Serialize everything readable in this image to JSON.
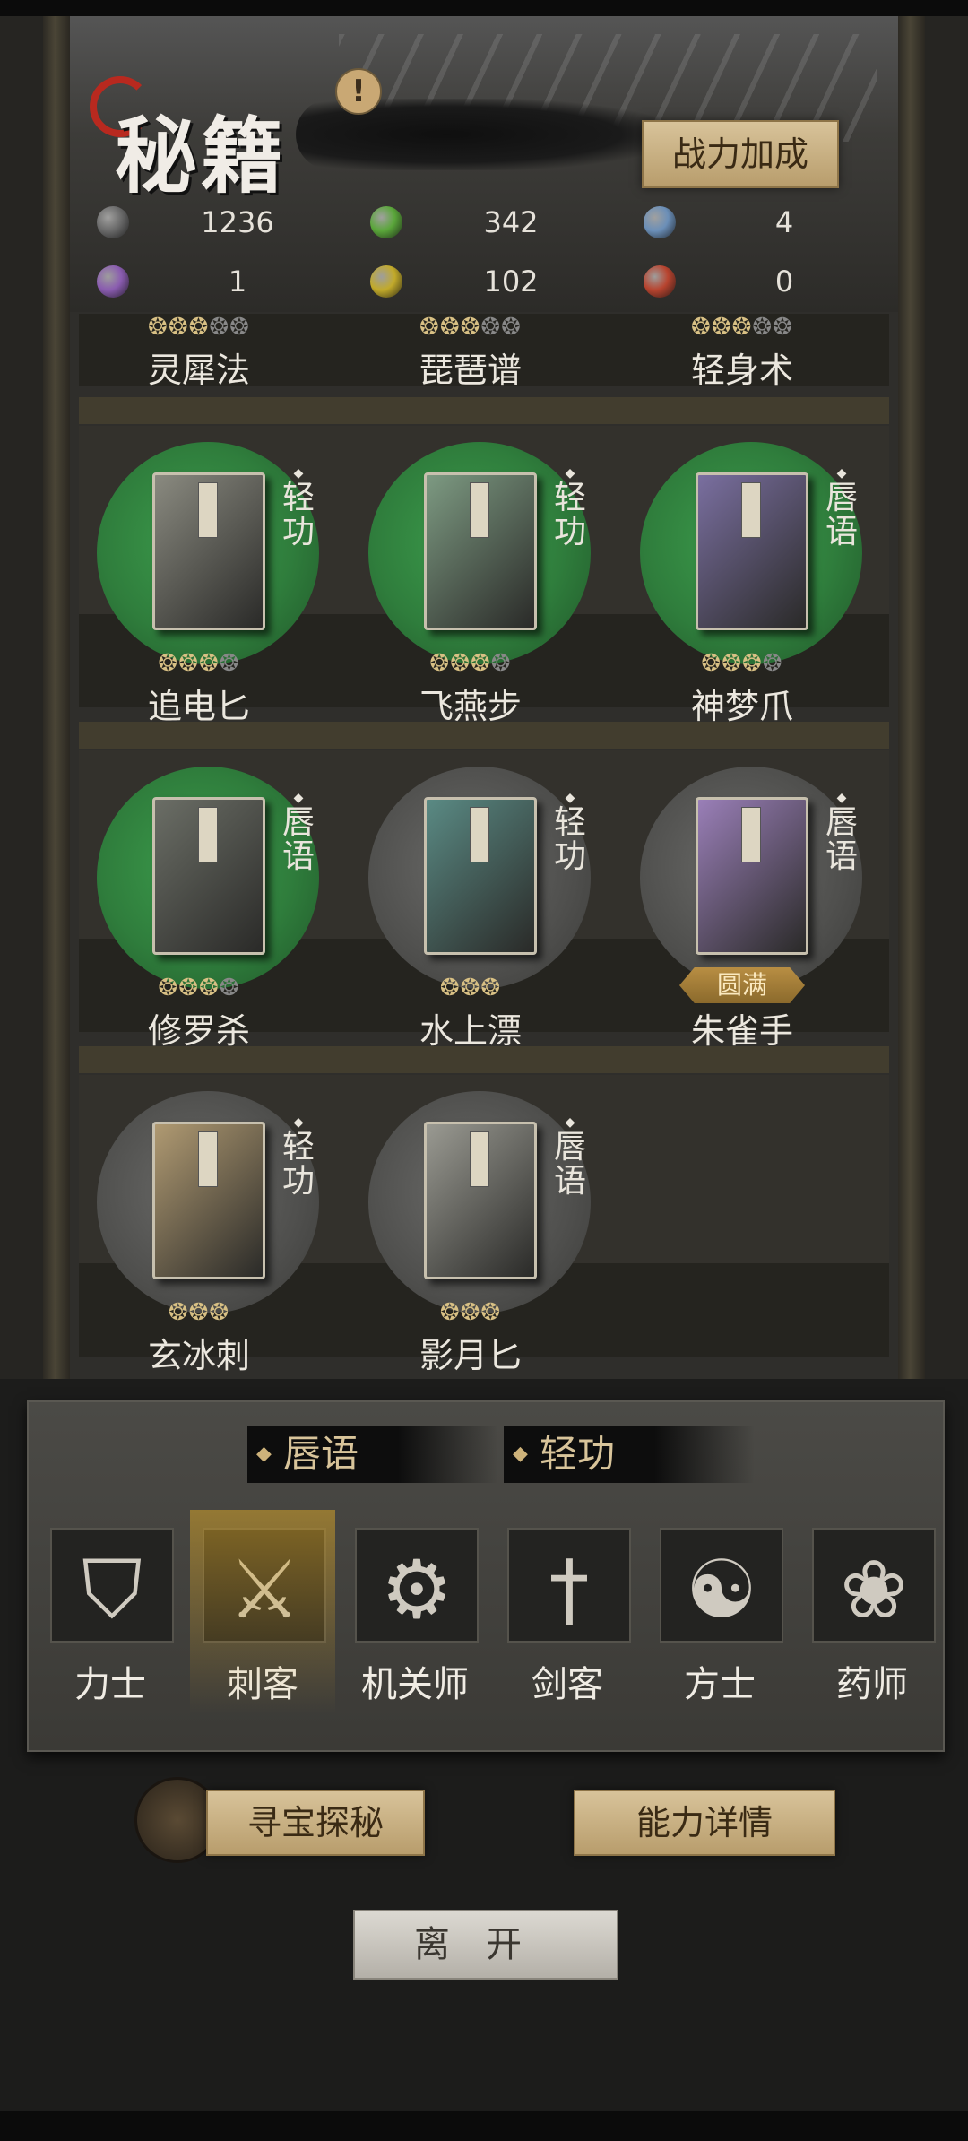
{
  "header": {
    "title": "秘籍",
    "alert_symbol": "!",
    "power_button": "战力加成"
  },
  "resources": [
    {
      "color": "#6a6a6a",
      "value": "1236"
    },
    {
      "color": "#5aa63a",
      "value": "342"
    },
    {
      "color": "#6b8fb8",
      "value": "4"
    },
    {
      "color": "#8a5cb0",
      "value": "1"
    },
    {
      "color": "#c2aa2a",
      "value": "102"
    },
    {
      "color": "#b8442f",
      "value": "0"
    }
  ],
  "partial_row": {
    "names": [
      "灵犀法",
      "琵琶谱",
      "轻身术"
    ],
    "stars": [
      3,
      3,
      3
    ],
    "max_stars": 5
  },
  "books": [
    {
      "name": "追电匕",
      "type": "轻功",
      "stars": 3,
      "max": 4,
      "disc": "green",
      "cover": "#8a8a80"
    },
    {
      "name": "飞燕步",
      "type": "轻功",
      "stars": 3,
      "max": 4,
      "disc": "green",
      "cover": "#7d9a82"
    },
    {
      "name": "神梦爪",
      "type": "唇语",
      "stars": 3,
      "max": 4,
      "disc": "green",
      "cover": "#7a6fa0"
    },
    {
      "name": "修罗杀",
      "type": "唇语",
      "stars": 3,
      "max": 4,
      "disc": "green",
      "cover": "#6b6e66"
    },
    {
      "name": "水上漂",
      "type": "轻功",
      "stars": 3,
      "max": 3,
      "disc": "grey",
      "cover": "#5a8a84"
    },
    {
      "name": "朱雀手",
      "type": "唇语",
      "stars": 0,
      "max": 0,
      "disc": "grey",
      "cover": "#9a7fb8",
      "badge": "圆满"
    },
    {
      "name": "玄冰刺",
      "type": "轻功",
      "stars": 3,
      "max": 3,
      "disc": "grey",
      "cover": "#b09a72"
    },
    {
      "name": "影月匕",
      "type": "唇语",
      "stars": 3,
      "max": 3,
      "disc": "grey",
      "cover": "#9a9a92"
    }
  ],
  "filter_chips": [
    "唇语",
    "轻功"
  ],
  "classes": [
    {
      "label": "力士",
      "icon": "shield-icon",
      "glyph": "⛉",
      "selected": false
    },
    {
      "label": "刺客",
      "icon": "dagger-icon",
      "glyph": "⚔",
      "selected": true
    },
    {
      "label": "机关师",
      "icon": "gear-icon",
      "glyph": "⚙",
      "selected": false
    },
    {
      "label": "剑客",
      "icon": "sword-icon",
      "glyph": "†",
      "selected": false
    },
    {
      "label": "方士",
      "icon": "yin-yang-icon",
      "glyph": "☯",
      "selected": false
    },
    {
      "label": "药师",
      "icon": "gourd-icon",
      "glyph": "❀",
      "selected": false
    }
  ],
  "bottom": {
    "treasure_button": "寻宝探秘",
    "detail_button": "能力详情",
    "leave_button": "离开"
  }
}
